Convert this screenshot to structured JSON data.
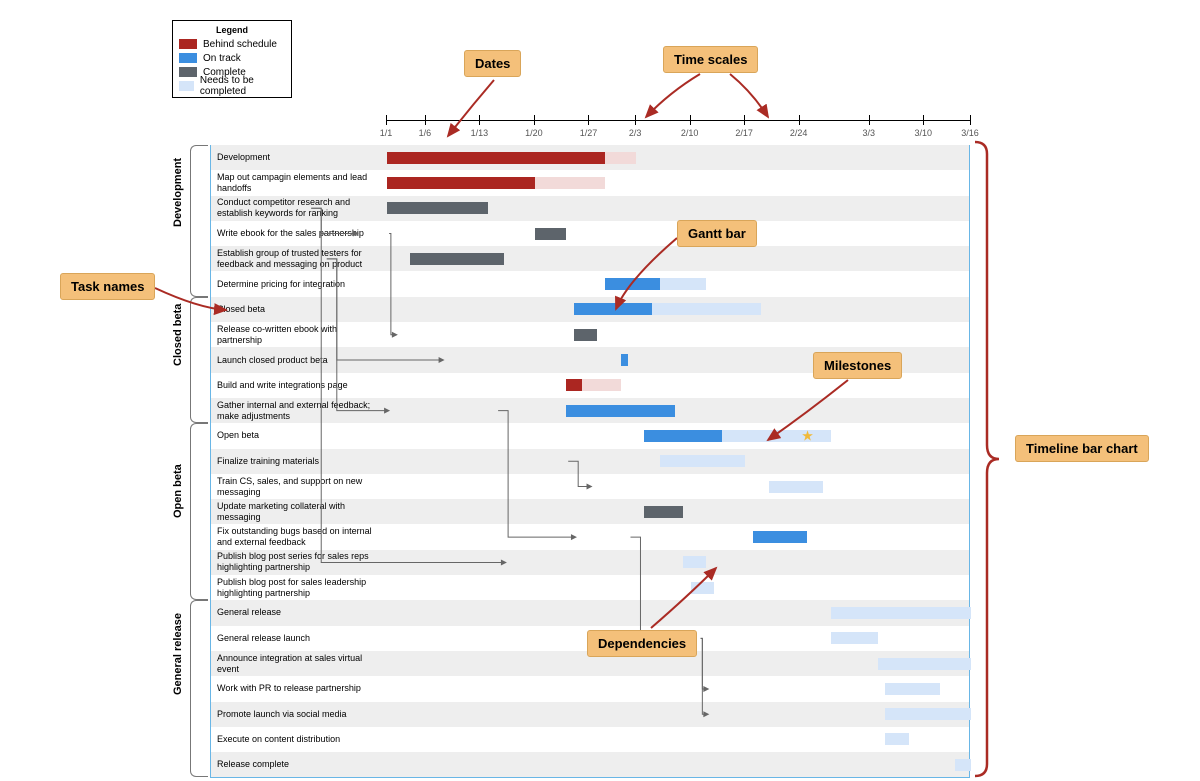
{
  "legend": {
    "title": "Legend",
    "items": [
      {
        "label": "Behind schedule",
        "color": "#ab2621"
      },
      {
        "label": "On track",
        "color": "#3b8ee0"
      },
      {
        "label": "Complete",
        "color": "#5d646b"
      },
      {
        "label": "Needs to be completed",
        "color": "#d5e5f9"
      }
    ]
  },
  "callouts": {
    "dates": "Dates",
    "time_scales": "Time scales",
    "task_names": "Task names",
    "gantt_bar": "Gantt bar",
    "milestones": "Milestones",
    "dependencies": "Dependencies",
    "timeline_bar": "Timeline bar chart"
  },
  "sections": [
    {
      "name": "Development",
      "rows": 6
    },
    {
      "name": "Closed beta",
      "rows": 5
    },
    {
      "name": "Open beta",
      "rows": 7
    },
    {
      "name": "General release",
      "rows": 7
    }
  ],
  "axis": {
    "ticks": [
      "1/1",
      "1/6",
      "1/13",
      "1/20",
      "1/27",
      "2/3",
      "2/10",
      "2/17",
      "2/24",
      "3/3",
      "3/10",
      "3/16"
    ]
  },
  "chart_data": {
    "type": "gantt",
    "xrange": [
      "1/1",
      "3/16"
    ],
    "legend": [
      "Behind schedule",
      "On track",
      "Complete",
      "Needs to be completed"
    ],
    "annotations": [
      "Dates",
      "Time scales",
      "Task names",
      "Gantt bar",
      "Milestones",
      "Dependencies",
      "Timeline bar chart"
    ],
    "tasks": [
      {
        "group": "Development",
        "name": "Development",
        "bars": [
          {
            "start": "1/1",
            "end": "1/29",
            "status": "behind"
          },
          {
            "start": "1/29",
            "end": "2/3",
            "status": "behind-lt"
          }
        ]
      },
      {
        "group": "Development",
        "name": "Map out campagin elements and lead handoffs",
        "bars": [
          {
            "start": "1/1",
            "end": "1/20",
            "status": "behind"
          },
          {
            "start": "1/20",
            "end": "1/29",
            "status": "behind-lt"
          }
        ]
      },
      {
        "group": "Development",
        "name": "Conduct competitor research and establish keywords for ranking",
        "bars": [
          {
            "start": "1/1",
            "end": "1/14",
            "status": "complete"
          }
        ]
      },
      {
        "group": "Development",
        "name": "Write ebook for the sales partnership",
        "bars": [
          {
            "start": "1/20",
            "end": "1/24",
            "status": "complete"
          }
        ],
        "dep_from": 2
      },
      {
        "group": "Development",
        "name": "Establish group of trusted testers for feedback and messaging on product",
        "bars": [
          {
            "start": "1/4",
            "end": "1/16",
            "status": "complete"
          }
        ]
      },
      {
        "group": "Development",
        "name": "Determine pricing for integration",
        "bars": [
          {
            "start": "1/29",
            "end": "2/6",
            "status": "ontrack"
          },
          {
            "start": "2/6",
            "end": "2/12",
            "status": "needs"
          }
        ]
      },
      {
        "group": "Closed beta",
        "name": "Closed beta",
        "bars": [
          {
            "start": "1/25",
            "end": "2/5",
            "status": "ontrack"
          },
          {
            "start": "2/5",
            "end": "2/19",
            "status": "needs"
          }
        ]
      },
      {
        "group": "Closed beta",
        "name": "Release co-written ebook with partnership",
        "bars": [
          {
            "start": "1/25",
            "end": "1/28",
            "status": "complete"
          }
        ],
        "dep_from": 3
      },
      {
        "group": "Closed beta",
        "name": "Launch closed product beta",
        "bars": [
          {
            "start": "1/31",
            "end": "2/2",
            "status": "ontrack"
          }
        ],
        "dep_from": 4
      },
      {
        "group": "Closed beta",
        "name": "Build and write integrations page",
        "bars": [
          {
            "start": "1/24",
            "end": "1/26",
            "status": "behind"
          },
          {
            "start": "1/26",
            "end": "2/1",
            "status": "behind-lt"
          }
        ]
      },
      {
        "group": "Closed beta",
        "name": "Gather internal and external feedback; make adjustments",
        "bars": [
          {
            "start": "1/24",
            "end": "2/8",
            "status": "ontrack"
          }
        ],
        "dep_from": 4
      },
      {
        "group": "Open beta",
        "name": "Open beta",
        "bars": [
          {
            "start": "2/4",
            "end": "2/14",
            "status": "ontrack"
          },
          {
            "start": "2/14",
            "end": "2/28",
            "status": "needs"
          }
        ],
        "milestone": "2/25"
      },
      {
        "group": "Open beta",
        "name": "Finalize training materials",
        "bars": [
          {
            "start": "2/6",
            "end": "2/17",
            "status": "needs"
          }
        ]
      },
      {
        "group": "Open beta",
        "name": "Train CS, sales, and support on new messaging",
        "bars": [
          {
            "start": "2/20",
            "end": "2/27",
            "status": "needs"
          }
        ],
        "dep_from": 12
      },
      {
        "group": "Open beta",
        "name": "Update marketing collateral with messaging",
        "bars": [
          {
            "start": "2/4",
            "end": "2/9",
            "status": "complete"
          }
        ]
      },
      {
        "group": "Open beta",
        "name": "Fix outstanding bugs based on internal and external feedback",
        "bars": [
          {
            "start": "2/18",
            "end": "2/25",
            "status": "ontrack"
          }
        ],
        "dep_from": 10
      },
      {
        "group": "Open beta",
        "name": "Publish blog post series for sales reps highlighting partnership",
        "bars": [
          {
            "start": "2/9",
            "end": "2/12",
            "status": "needs"
          }
        ],
        "dep_from": 2
      },
      {
        "group": "Open beta",
        "name": "Publish blog post for sales leadership highlighting partnership",
        "bars": [
          {
            "start": "2/10",
            "end": "2/13",
            "status": "needs"
          }
        ]
      },
      {
        "group": "General release",
        "name": "General release",
        "bars": [
          {
            "start": "2/28",
            "end": "3/16",
            "status": "needs"
          }
        ]
      },
      {
        "group": "General release",
        "name": "General release launch",
        "bars": [
          {
            "start": "2/28",
            "end": "3/4",
            "status": "needs"
          }
        ],
        "dep_from": 15
      },
      {
        "group": "General release",
        "name": "Announce integration at sales virtual event",
        "bars": [
          {
            "start": "3/4",
            "end": "3/16",
            "status": "needs"
          }
        ]
      },
      {
        "group": "General release",
        "name": "Work with PR to release partnership",
        "bars": [
          {
            "start": "3/5",
            "end": "3/12",
            "status": "needs"
          }
        ],
        "dep_from": 19
      },
      {
        "group": "General release",
        "name": "Promote launch via social media",
        "bars": [
          {
            "start": "3/5",
            "end": "3/16",
            "status": "needs"
          }
        ],
        "dep_from": 19
      },
      {
        "group": "General release",
        "name": "Execute on content distribution",
        "bars": [
          {
            "start": "3/5",
            "end": "3/8",
            "status": "needs"
          }
        ]
      },
      {
        "group": "General release",
        "name": "Release complete",
        "bars": [
          {
            "start": "3/14",
            "end": "3/16",
            "status": "needs"
          }
        ]
      }
    ]
  }
}
